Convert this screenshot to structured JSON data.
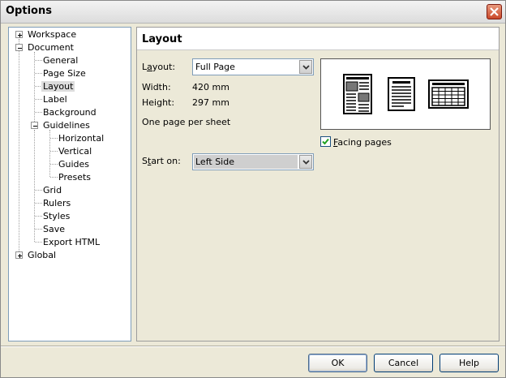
{
  "window": {
    "title": "Options"
  },
  "tree": {
    "items": [
      {
        "label": "Workspace",
        "expander": "plus"
      },
      {
        "label": "Document",
        "expander": "minus"
      },
      {
        "label": "General"
      },
      {
        "label": "Page Size"
      },
      {
        "label": "Layout",
        "selected": true
      },
      {
        "label": "Label"
      },
      {
        "label": "Background"
      },
      {
        "label": "Guidelines",
        "expander": "minus"
      },
      {
        "label": "Horizontal"
      },
      {
        "label": "Vertical"
      },
      {
        "label": "Guides"
      },
      {
        "label": "Presets"
      },
      {
        "label": "Grid"
      },
      {
        "label": "Rulers"
      },
      {
        "label": "Styles"
      },
      {
        "label": "Save"
      },
      {
        "label": "Export HTML"
      },
      {
        "label": "Global",
        "expander": "plus"
      }
    ]
  },
  "panel": {
    "title": "Layout",
    "layout_label_pre": "L",
    "layout_label_ul": "a",
    "layout_label_post": "yout:",
    "layout_value": "Full Page",
    "width_label": "Width:",
    "width_value": "420 mm",
    "height_label": "Height:",
    "height_value": "297 mm",
    "pages_info": "One page per sheet",
    "facing_pre": "",
    "facing_ul": "F",
    "facing_post": "acing pages",
    "facing_checked": true,
    "start_label_pre": "S",
    "start_label_ul": "t",
    "start_label_post": "art on:",
    "start_value": "Left Side",
    "preview_icons": [
      "full-page-document-icon",
      "booklet-page-icon",
      "table-page-icon"
    ]
  },
  "buttons": {
    "ok": "OK",
    "cancel": "Cancel",
    "help": "Help"
  },
  "colors": {
    "accent_close": "#c9482a",
    "field_border": "#7f9db9"
  }
}
